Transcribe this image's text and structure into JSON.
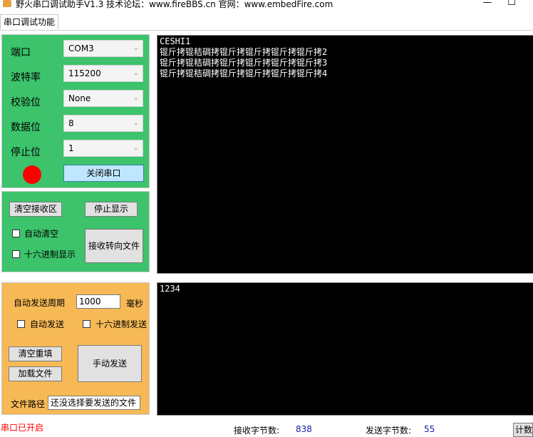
{
  "titlebar": {
    "title": "野火串口调试助手V1.3    技术论坛：www.fireBBS.cn    官网：www.embedFire.com",
    "minimize": "—",
    "maximize": "☐"
  },
  "tab": {
    "label": "串口调试功能"
  },
  "serial": {
    "port_label": "端口",
    "port_value": "COM3",
    "baud_label": "波特率",
    "baud_value": "115200",
    "parity_label": "校验位",
    "parity_value": "None",
    "databits_label": "数据位",
    "databits_value": "8",
    "stopbits_label": "停止位",
    "stopbits_value": "1",
    "status_color": "#ff0000",
    "close_button": "关闭串口"
  },
  "receive": {
    "clear_button": "清空接收区",
    "stop_button": "停止显示",
    "auto_clear": "自动清空",
    "hex_display": "十六进制显示",
    "to_file_button": "接收转向文件",
    "lines": [
      "CESHI1",
      "锟斤拷锟秸碉拷锟斤拷锟斤拷锟斤拷锟斤拷2",
      "锟斤拷锟秸碉拷锟斤拷锟斤拷锟斤拷锟斤拷3",
      "锟斤拷锟秸碉拷锟斤拷锟斤拷锟斤拷锟斤拷4"
    ]
  },
  "send": {
    "period_label": "自动发送周期",
    "period_value": "1000",
    "period_unit": "毫秒",
    "auto_send": "自动发送",
    "hex_send": "十六进制发送",
    "clear_fill_button": "清空重填",
    "load_file_button": "加载文件",
    "manual_send_button": "手动发送",
    "file_path_label": "文件路径",
    "file_path_value": "还没选择要发送的文件",
    "text": "1234"
  },
  "status": {
    "port_state": "串口已开启",
    "rx_label": "接收字节数:",
    "rx_value": "838",
    "tx_label": "发送字节数:",
    "tx_value": "55",
    "count_button": "计数"
  }
}
